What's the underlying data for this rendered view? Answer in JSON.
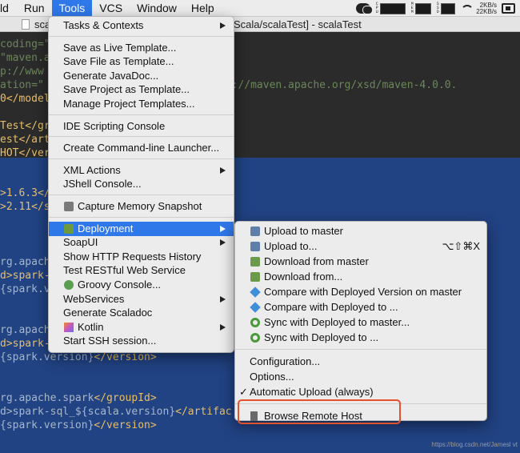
{
  "menubar": {
    "items": [
      "ld",
      "Run",
      "Tools",
      "VCS",
      "Window",
      "Help"
    ],
    "active_index": 2,
    "stat_labels": [
      "CPU",
      "MEM",
      "SSD"
    ],
    "net_up": "2KB/s",
    "net_down": "22KB/s"
  },
  "titlebar": {
    "left_text": "sca",
    "title": "Scala/scalaTest] - scalaTest"
  },
  "editor": {
    "lines": [
      [
        {
          "t": "coding=\"",
          "c": "str"
        }
      ],
      [
        {
          "t": "\"maven.a",
          "c": "str"
        }
      ],
      [
        {
          "t": "p://www",
          "c": "str"
        },
        {
          "t": "                       ",
          "c": "txt"
        },
        {
          "t": "nce\"",
          "c": "str"
        }
      ],
      [
        {
          "t": "ation=\"",
          "c": "str"
        },
        {
          "t": "                     ",
          "c": "txt"
        },
        {
          "t": ".0.0 http://maven.apache.org/xsd/maven-4.0.0.",
          "c": "str"
        }
      ],
      [
        {
          "t": "0</model",
          "c": "tag"
        }
      ],
      [
        {
          "t": "",
          "c": "txt"
        }
      ],
      [
        {
          "t": "Test</gr",
          "c": "tag"
        }
      ],
      [
        {
          "t": "est</art",
          "c": "tag"
        }
      ],
      [
        {
          "t": "HOT</ver",
          "c": "tag"
        }
      ],
      [
        {
          "t": "",
          "c": "txt"
        }
      ],
      [
        {
          "t": "",
          "c": "txt"
        }
      ],
      [
        {
          "t": ">1.6.3</",
          "c": "tag"
        }
      ],
      [
        {
          "t": ">2.11</s",
          "c": "tag"
        }
      ],
      [
        {
          "t": "",
          "c": "txt"
        }
      ],
      [
        {
          "t": "",
          "c": "txt"
        }
      ],
      [
        {
          "t": "",
          "c": "txt"
        }
      ],
      [
        {
          "t": "rg.apache",
          "c": "txt"
        }
      ],
      [
        {
          "t": "d>spark-",
          "c": "tag"
        }
      ],
      [
        {
          "t": "{spark.ve",
          "c": "txt"
        }
      ],
      [
        {
          "t": "",
          "c": "txt"
        }
      ],
      [
        {
          "t": "",
          "c": "txt"
        }
      ],
      [
        {
          "t": "rg.apache",
          "c": "txt"
        }
      ],
      [
        {
          "t": "d>spark-",
          "c": "tag"
        }
      ],
      [
        {
          "t": "{spark.version}",
          "c": "txt"
        },
        {
          "t": "</version>",
          "c": "tag"
        }
      ],
      [
        {
          "t": "",
          "c": "txt"
        }
      ],
      [
        {
          "t": "",
          "c": "txt"
        }
      ],
      [
        {
          "t": "rg.apache.spark",
          "c": "txt"
        },
        {
          "t": "</groupId>",
          "c": "tag"
        }
      ],
      [
        {
          "t": "d>spark-sql_${scala.version}",
          "c": "txt"
        },
        {
          "t": "</artifac",
          "c": "tag"
        }
      ],
      [
        {
          "t": "{spark.version}",
          "c": "txt"
        },
        {
          "t": "</version>",
          "c": "tag"
        }
      ]
    ]
  },
  "tools_menu": {
    "items": [
      {
        "label": "Tasks & Contexts",
        "sub": true
      },
      {
        "sep": true
      },
      {
        "label": "Save as Live Template..."
      },
      {
        "label": "Save File as Template..."
      },
      {
        "label": "Generate JavaDoc..."
      },
      {
        "label": "Save Project as Template..."
      },
      {
        "label": "Manage Project Templates..."
      },
      {
        "sep": true
      },
      {
        "label": "IDE Scripting Console"
      },
      {
        "sep": true
      },
      {
        "label": "Create Command-line Launcher..."
      },
      {
        "sep": true
      },
      {
        "label": "XML Actions",
        "sub": true
      },
      {
        "label": "JShell Console..."
      },
      {
        "sep": true
      },
      {
        "label": "Capture Memory Snapshot",
        "icon": "camera-icon"
      },
      {
        "sep": true
      },
      {
        "label": "Deployment",
        "sub": true,
        "icon": "deployment-icon",
        "highlighted": true
      },
      {
        "label": "SoapUI",
        "sub": true
      },
      {
        "label": "Show HTTP Requests History"
      },
      {
        "label": "Test RESTful Web Service"
      },
      {
        "label": "Groovy Console...",
        "icon": "groovy-icon"
      },
      {
        "label": "WebServices",
        "sub": true
      },
      {
        "label": "Generate Scaladoc"
      },
      {
        "label": "Kotlin",
        "sub": true,
        "icon": "kotlin-icon"
      },
      {
        "label": "Start SSH session..."
      }
    ]
  },
  "deployment_menu": {
    "items": [
      {
        "label": "Upload to master",
        "icon": "upload-icon"
      },
      {
        "label": "Upload to...",
        "icon": "upload-icon",
        "shortcut": "⌥⇧⌘X"
      },
      {
        "label": "Download from master",
        "icon": "download-icon"
      },
      {
        "label": "Download from...",
        "icon": "download-icon"
      },
      {
        "label": "Compare with Deployed Version on master",
        "icon": "compare-icon"
      },
      {
        "label": "Compare with Deployed to ...",
        "icon": "compare-icon"
      },
      {
        "label": "Sync with Deployed to master...",
        "icon": "sync-icon"
      },
      {
        "label": "Sync with Deployed to ...",
        "icon": "sync-icon"
      },
      {
        "sep": true
      },
      {
        "label": "Configuration..."
      },
      {
        "label": "Options..."
      },
      {
        "label": "Automatic Upload (always)",
        "checked": true,
        "check_mark": "✓"
      },
      {
        "sep": true
      },
      {
        "label": "Browse Remote Host",
        "icon": "server-icon",
        "emphasized": true
      }
    ]
  },
  "watermark": "https://blog.csdn.net/Jamesl vt",
  "colors": {
    "highlight": "#2f78ea",
    "annotation_box": "#e0532d",
    "selection": "#214283"
  }
}
